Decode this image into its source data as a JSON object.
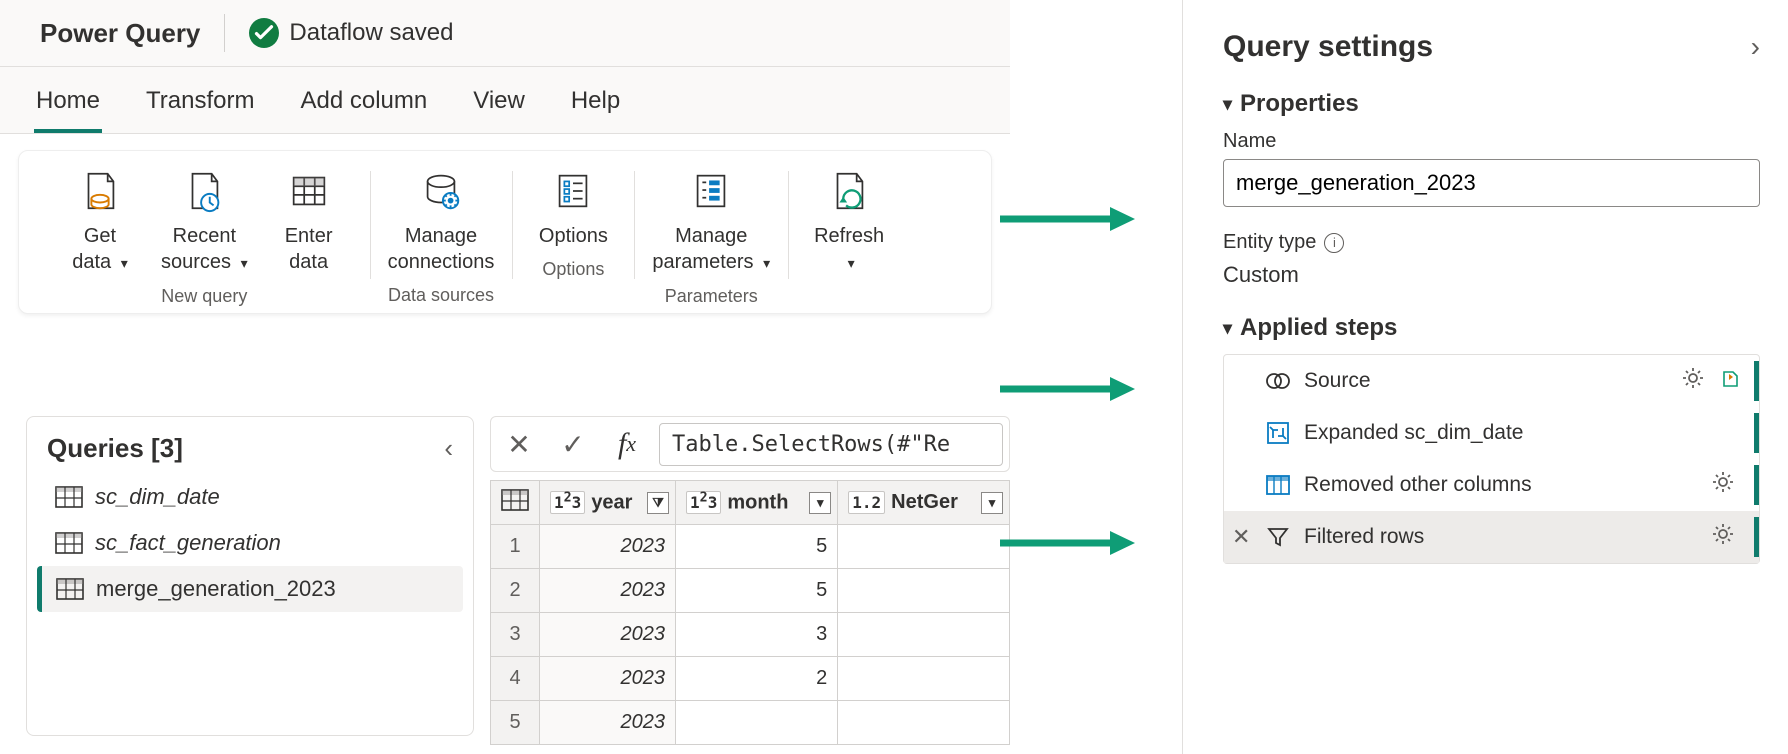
{
  "titlebar": {
    "title": "Power Query",
    "status": "Dataflow saved"
  },
  "tabs": [
    "Home",
    "Transform",
    "Add column",
    "View",
    "Help"
  ],
  "active_tab_index": 0,
  "ribbon": {
    "groups": [
      {
        "label": "New query",
        "buttons": [
          {
            "id": "get-data",
            "label": "Get\ndata",
            "caret": true
          },
          {
            "id": "recent-sources",
            "label": "Recent\nsources",
            "caret": true
          },
          {
            "id": "enter-data",
            "label": "Enter\ndata",
            "caret": false
          }
        ]
      },
      {
        "label": "Data sources",
        "buttons": [
          {
            "id": "manage-connections",
            "label": "Manage\nconnections",
            "caret": false
          }
        ]
      },
      {
        "label": "Options",
        "buttons": [
          {
            "id": "options",
            "label": "Options",
            "caret": false
          }
        ]
      },
      {
        "label": "Parameters",
        "buttons": [
          {
            "id": "manage-parameters",
            "label": "Manage\nparameters",
            "caret": true
          }
        ]
      },
      {
        "label": "",
        "buttons": [
          {
            "id": "refresh",
            "label": "Refresh",
            "caret": true
          }
        ]
      }
    ]
  },
  "queries": {
    "title": "Queries",
    "count": 3,
    "items": [
      {
        "name": "sc_dim_date",
        "selected": false,
        "italic": true
      },
      {
        "name": "sc_fact_generation",
        "selected": false,
        "italic": true
      },
      {
        "name": "merge_generation_2023",
        "selected": true,
        "italic": false
      }
    ]
  },
  "formula": "Table.SelectRows(#\"Re",
  "grid": {
    "columns": [
      {
        "type": "1²3",
        "name": "year",
        "filter": true
      },
      {
        "type": "1²3",
        "name": "month",
        "filter": false
      },
      {
        "type": "1.2",
        "name": "NetGer",
        "filter": false,
        "truncated": true
      }
    ],
    "rows": [
      {
        "n": 1,
        "year": 2023,
        "month": 5
      },
      {
        "n": 2,
        "year": 2023,
        "month": 5
      },
      {
        "n": 3,
        "year": 2023,
        "month": 3
      },
      {
        "n": 4,
        "year": 2023,
        "month": 2
      },
      {
        "n": 5,
        "year": 2023,
        "month": null
      }
    ]
  },
  "settings": {
    "title": "Query settings",
    "properties_label": "Properties",
    "name_label": "Name",
    "name_value": "merge_generation_2023",
    "entity_type_label": "Entity type",
    "entity_type_value": "Custom",
    "applied_steps_label": "Applied steps",
    "steps": [
      {
        "icon": "source",
        "label": "Source",
        "gear": true,
        "extra": true
      },
      {
        "icon": "expand",
        "label": "Expanded sc_dim_date",
        "gear": false
      },
      {
        "icon": "columns",
        "label": "Removed other columns",
        "gear": true
      },
      {
        "icon": "filter",
        "label": "Filtered rows",
        "gear": true,
        "selected": true
      }
    ]
  }
}
